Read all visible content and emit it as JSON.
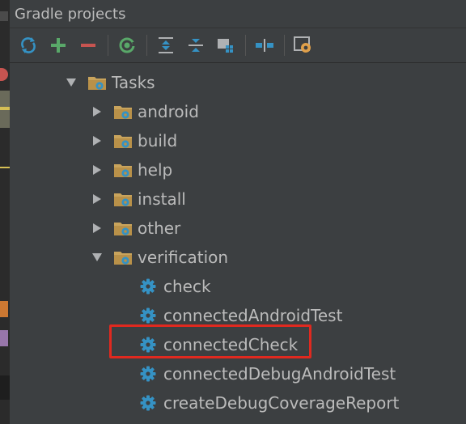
{
  "window": {
    "title": "Gradle projects"
  },
  "toolbar": {
    "buttons": [
      {
        "icon": "refresh-icon",
        "color": "#3592c4"
      },
      {
        "icon": "plus-icon",
        "color": "#59a869"
      },
      {
        "icon": "minus-icon",
        "color": "#c75450"
      },
      {
        "icon": "run-icon",
        "color": "#59a869"
      },
      {
        "icon": "expand-all-icon",
        "color": "#afb1b3"
      },
      {
        "icon": "collapse-all-icon",
        "color": "#afb1b3"
      },
      {
        "icon": "group-modules-icon",
        "color": "#3592c4"
      },
      {
        "icon": "offline-mode-icon",
        "color": "#3592c4"
      },
      {
        "icon": "settings-icon",
        "color": "#e0a04a"
      }
    ]
  },
  "tree": {
    "root": {
      "label": "Tasks",
      "expanded": true
    },
    "groups": [
      {
        "label": "android",
        "expanded": false
      },
      {
        "label": "build",
        "expanded": false
      },
      {
        "label": "help",
        "expanded": false
      },
      {
        "label": "install",
        "expanded": false
      },
      {
        "label": "other",
        "expanded": false
      },
      {
        "label": "verification",
        "expanded": true
      }
    ],
    "tasks": [
      {
        "label": "check"
      },
      {
        "label": "connectedAndroidTest"
      },
      {
        "label": "connectedCheck",
        "highlighted": true
      },
      {
        "label": "connectedDebugAndroidTest"
      },
      {
        "label": "createDebugCoverageReport"
      }
    ]
  },
  "colors": {
    "background": "#3c3f41",
    "text": "#bbbbbb",
    "folder": "#c9a45c",
    "gear": "#3592c4",
    "highlight": "#e0291f"
  }
}
